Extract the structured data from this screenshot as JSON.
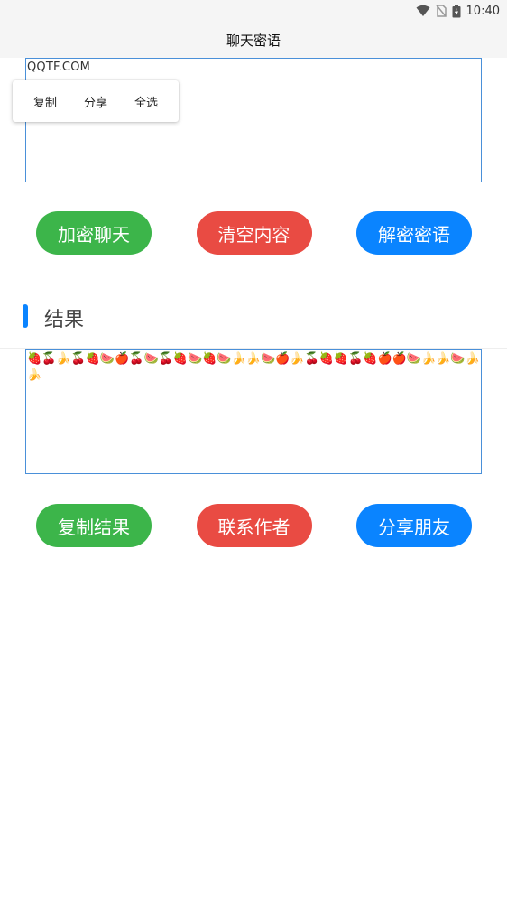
{
  "status": {
    "time": "10:40"
  },
  "appbar": {
    "title": "聊天密语"
  },
  "input": {
    "value": "QQTF.COM"
  },
  "context_menu": {
    "copy": "复制",
    "share": "分享",
    "select_all": "全选"
  },
  "buttons_top": {
    "encrypt": "加密聊天",
    "clear": "清空内容",
    "decrypt": "解密密语"
  },
  "result": {
    "title": "结果",
    "value": "🍓🍒🍌🍒🍓🍉🍎🍒🍉🍒🍓🍉🍓🍉🍌🍌🍉🍎🍌🍒🍓🍓🍒🍓🍎🍎🍉🍌🍌🍉🍌🍌"
  },
  "buttons_bottom": {
    "copy_result": "复制结果",
    "contact_author": "联系作者",
    "share_friend": "分享朋友"
  }
}
